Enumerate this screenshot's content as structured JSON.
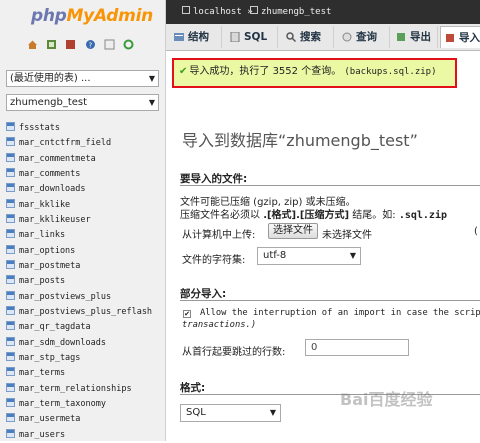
{
  "logo": {
    "php": "php",
    "my": "My",
    "admin": "Admin"
  },
  "left_panel": {
    "recent_select": "(最近使用的表) ...",
    "db_select": "zhumengb_test",
    "tables": [
      "fssstats",
      "mar_cntctfrm_field",
      "mar_commentmeta",
      "mar_comments",
      "mar_downloads",
      "mar_kklike",
      "mar_kklikeuser",
      "mar_links",
      "mar_options",
      "mar_postmeta",
      "mar_posts",
      "mar_postviews_plus",
      "mar_postviews_plus_reflash",
      "mar_qr_tagdata",
      "mar_sdm_downloads",
      "mar_stp_tags",
      "mar_terms",
      "mar_term_relationships",
      "mar_term_taxonomy",
      "mar_usermeta",
      "mar_users"
    ]
  },
  "breadcrumb": {
    "server": "localhost",
    "database": "zhumengb_test"
  },
  "tabs": [
    "结构",
    "SQL",
    "搜索",
    "查询",
    "导出",
    "导入"
  ],
  "message": {
    "text": "导入成功，执行了 3552 个查询。",
    "file": "(backups.sql.zip)"
  },
  "page_title": "导入到数据库“zhumengb_test”",
  "file_section": {
    "heading": "要导入的文件:",
    "note1": "文件可能已压缩 (gzip, zip) 或未压缩。",
    "note2_prefix": "压缩文件名必须以",
    "note2_format": ".[格式].[压缩方式]",
    "note2_suffix": "结尾。如:",
    "note2_example": ".sql.zip",
    "upload_label": "从计算机中上传:",
    "choose_button": "选择文件",
    "no_file": "未选择文件",
    "right_edge": "(",
    "charset_label": "文件的字符集:",
    "charset_value": "utf-8"
  },
  "partial_section": {
    "heading": "部分导入:",
    "allow_line1": "Allow the interruption of an import in case the script d",
    "allow_line2": "transactions.)",
    "skip_label": "从首行起要跳过的行数:",
    "skip_value": "0"
  },
  "format_section": {
    "heading": "格式:",
    "value": "SQL"
  },
  "watermark": "Bai百度经验",
  "colors": {
    "accent_red": "#e3101a",
    "success_bg": "#ebf8a4",
    "topbar": "#2e2e2e"
  }
}
